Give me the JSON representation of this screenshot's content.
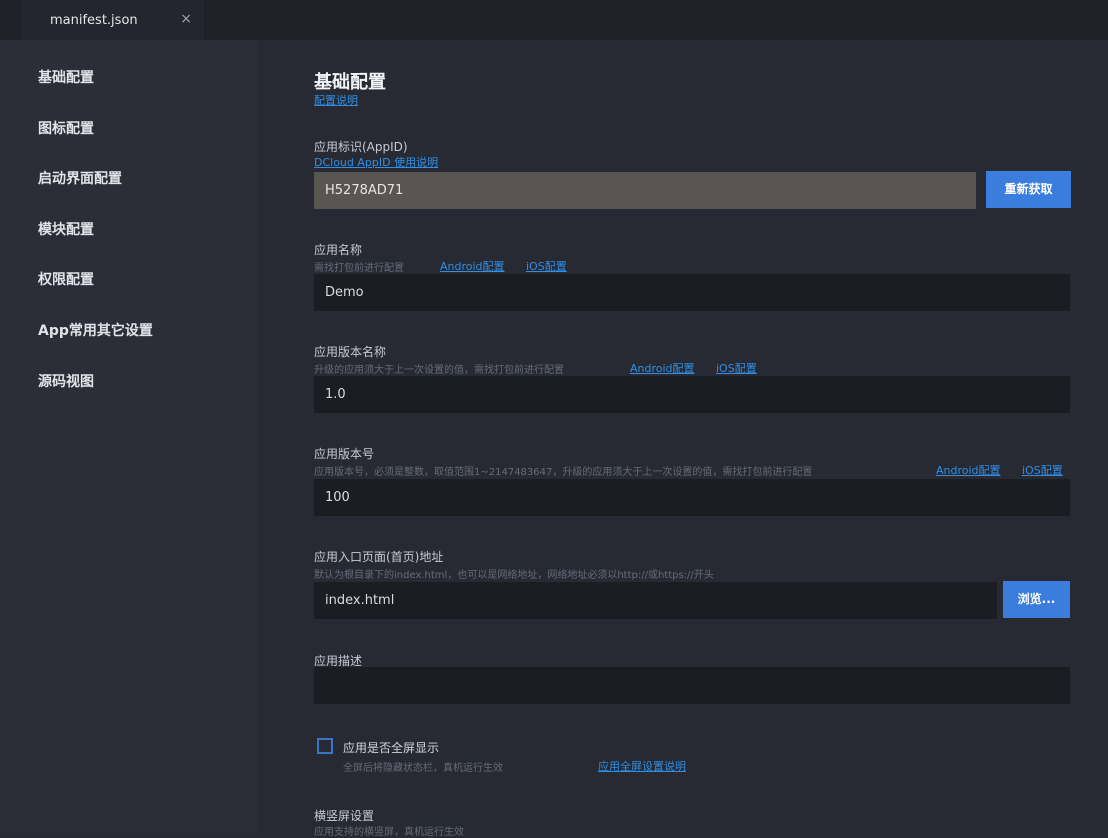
{
  "tab": {
    "title": "manifest.json",
    "close": "×"
  },
  "sidebar": {
    "items": [
      {
        "label": "基础配置"
      },
      {
        "label": "图标配置"
      },
      {
        "label": "启动界面配置"
      },
      {
        "label": "模块配置"
      },
      {
        "label": "权限配置"
      },
      {
        "label": "App常用其它设置"
      },
      {
        "label": "源码视图"
      }
    ]
  },
  "main": {
    "title": "基础配置",
    "config_link": "配置说明",
    "appid": {
      "label": "应用标识(AppID)",
      "link": "DCloud AppID 使用说明",
      "value": "H5278AD71",
      "button": "重新获取"
    },
    "app_name": {
      "label": "应用名称",
      "desc": "需找打包前进行配置",
      "android_link": "Android配置",
      "ios_link": "iOS配置",
      "value": "Demo"
    },
    "version_name": {
      "label": "应用版本名称",
      "desc": "升级的应用须大于上一次设置的值，需找打包前进行配置",
      "android_link": "Android配置",
      "ios_link": "iOS配置",
      "value": "1.0"
    },
    "version_code": {
      "label": "应用版本号",
      "desc": "应用版本号，必须是整数，取值范围1~2147483647，升级的应用须大于上一次设置的值，需找打包前进行配置",
      "android_link": "Android配置",
      "ios_link": "iOS配置",
      "value": "100"
    },
    "entry": {
      "label": "应用入口页面(首页)地址",
      "desc": "默认为根目录下的index.html，也可以是网络地址，网络地址必须以http://或https://开头",
      "value": "index.html",
      "button": "浏览..."
    },
    "description": {
      "label": "应用描述",
      "value": ""
    },
    "fullscreen": {
      "label": "应用是否全屏显示",
      "desc": "全屏后将隐藏状态栏，真机运行生效",
      "link": "应用全屏设置说明"
    },
    "orientation": {
      "label": "横竖屏设置",
      "desc": "应用支持的横竖屏，真机运行生效"
    }
  },
  "colors": {
    "accent": "#3b7ddd",
    "link": "#2f8ee6",
    "background": "#272a33",
    "sidebar": "#2b2e36",
    "input": "#1b1d22",
    "disabled_input": "#5a5452"
  }
}
